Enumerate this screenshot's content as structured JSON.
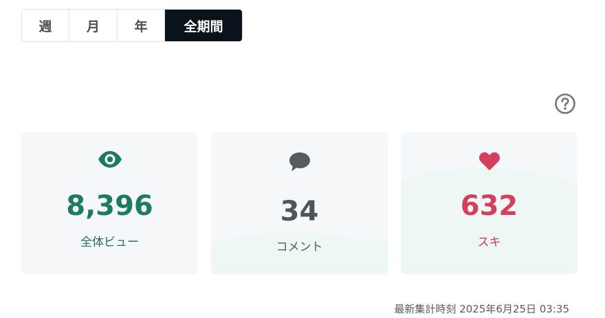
{
  "period_tabs": [
    {
      "label": "週",
      "active": false
    },
    {
      "label": "月",
      "active": false
    },
    {
      "label": "年",
      "active": false
    },
    {
      "label": "全期間",
      "active": true
    }
  ],
  "help_icon": "question-circle-icon",
  "stats": {
    "views": {
      "value": "8,396",
      "label": "全体ビュー",
      "icon": "eye-icon",
      "color": "#1f7a64"
    },
    "comments": {
      "value": "34",
      "label": "コメント",
      "icon": "speech-bubble-icon",
      "color": "#4e545a"
    },
    "likes": {
      "value": "632",
      "label": "スキ",
      "icon": "heart-icon",
      "color": "#d2405d"
    }
  },
  "footer": {
    "updated_label": "最新集計時刻",
    "updated_at": "2025年6月25日 03:35"
  }
}
